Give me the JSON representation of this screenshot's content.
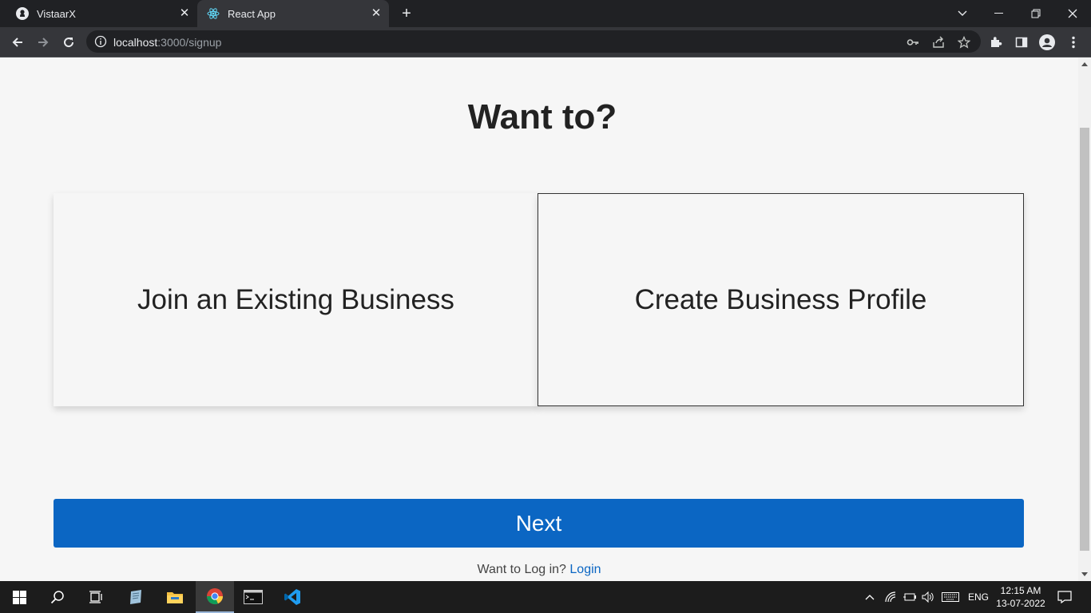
{
  "browser": {
    "tabs": [
      {
        "title": "VistaarX",
        "active": false
      },
      {
        "title": "React App",
        "active": true
      }
    ],
    "url_host": "localhost",
    "url_path": ":3000/signup"
  },
  "page": {
    "heading": "Want to?",
    "options": [
      {
        "label": "Join an Existing Business",
        "selected": false
      },
      {
        "label": "Create Business Profile",
        "selected": true
      }
    ],
    "next_label": "Next",
    "login_prompt": "Want to Log in?",
    "login_link": "Login"
  },
  "taskbar": {
    "language": "ENG",
    "time": "12:15 AM",
    "date": "13-07-2022"
  },
  "colors": {
    "primary": "#0b66c3",
    "page_bg": "#f6f6f6",
    "browser_dark": "#202124"
  }
}
